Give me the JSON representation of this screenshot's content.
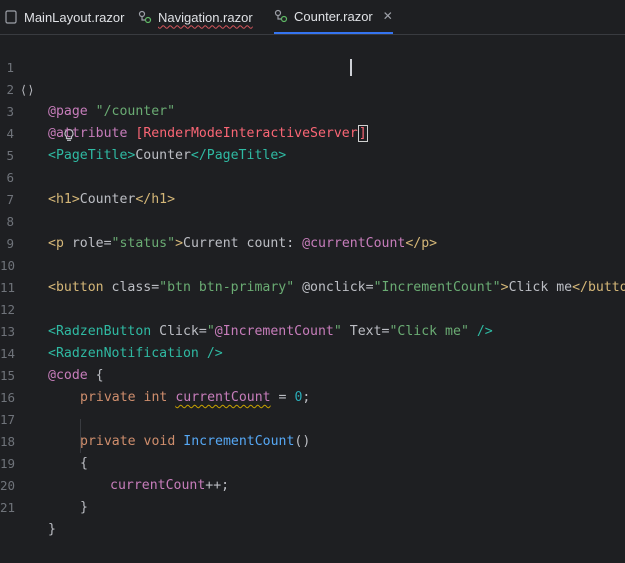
{
  "tabs": [
    {
      "label": "MainLayout.razor",
      "icon": "razor-file-icon",
      "active": false
    },
    {
      "label": "Navigation.razor",
      "icon": "razor-component-icon",
      "active": false
    },
    {
      "label": "Counter.razor",
      "icon": "razor-component-icon",
      "active": true,
      "close": "✕"
    }
  ],
  "gutter_icons": {
    "line1": "⟨⟩",
    "line2": "bulb-icon"
  },
  "lines": [
    {
      "n": "1"
    },
    {
      "n": "2"
    },
    {
      "n": "3"
    },
    {
      "n": "4"
    },
    {
      "n": "5"
    },
    {
      "n": "6"
    },
    {
      "n": "7"
    },
    {
      "n": "8"
    },
    {
      "n": "9"
    },
    {
      "n": "10"
    },
    {
      "n": "11"
    },
    {
      "n": "12"
    },
    {
      "n": "13"
    },
    {
      "n": "14"
    },
    {
      "n": "15"
    },
    {
      "n": "16"
    },
    {
      "n": "17"
    },
    {
      "n": "18"
    },
    {
      "n": "19"
    },
    {
      "n": "20"
    },
    {
      "n": "21"
    }
  ],
  "code": {
    "l1": {
      "dir": "@page",
      "str": "\"/counter\""
    },
    "l2": {
      "dir": "@attribute",
      "open": "[",
      "val": "RenderModeInteractiveServer",
      "close": "]"
    },
    "l4": {
      "open": "<PageTitle>",
      "text": "Counter",
      "close": "</PageTitle>"
    },
    "l6": {
      "open": "<h1>",
      "text": "Counter",
      "close": "</h1>"
    },
    "l8": {
      "open": "<p",
      "attr": "role=",
      "val": "\"status\"",
      "gt": ">",
      "text": "Current count: ",
      "at": "@",
      "var": "currentCount",
      "close": "</p>"
    },
    "l10": {
      "open": "<button",
      "attr1": "class=",
      "val1": "\"btn btn-primary\"",
      "attr2": "@onclick=",
      "val2": "\"IncrementCount\"",
      "gt": ">",
      "text": "Click me",
      "close": "</button>"
    },
    "l12": {
      "open": "<RadzenButton",
      "attr1": "Click=",
      "q1": "\"",
      "at": "@",
      "method": "IncrementCount",
      "q2": "\"",
      "attr2": "Text=",
      "val2": "\"Click me\"",
      "end": "/>"
    },
    "l13": {
      "open": "<RadzenNotification",
      "end": "/>"
    },
    "l14": {
      "dir": "@code",
      "brace": "{"
    },
    "l15": {
      "k1": "private",
      "k2": "int",
      "field": "currentCount",
      "eq": "=",
      "num": "0",
      "semi": ";"
    },
    "l17": {
      "k1": "private",
      "k2": "void",
      "method": "IncrementCount",
      "parens": "()"
    },
    "l18": {
      "brace": "{"
    },
    "l19": {
      "field": "currentCount",
      "op": "++;"
    },
    "l20": {
      "brace": "}"
    },
    "l21": {
      "brace": "}"
    }
  }
}
